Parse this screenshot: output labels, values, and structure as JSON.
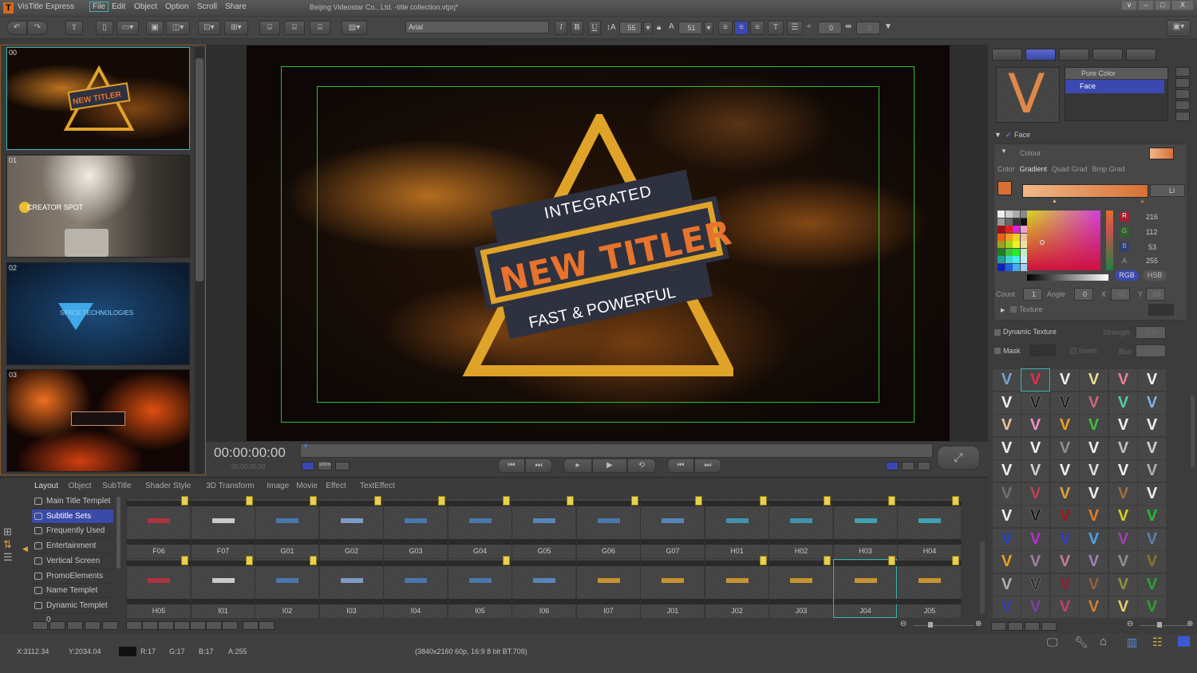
{
  "app": {
    "name": "VisTitle Express",
    "logo": "T",
    "window_title": "Beijing Videostar Co., Ltd. -title collection.vtprj*"
  },
  "menu": [
    "File",
    "Edit",
    "Object",
    "Option",
    "Scroll",
    "Share"
  ],
  "window_controls": [
    "∨",
    "–",
    "□",
    "X"
  ],
  "toolbar": {
    "font": "Arial",
    "font_size": "55",
    "char_width": "51",
    "line_spacing": "0",
    "char_spacing": "3"
  },
  "scenes": [
    {
      "num": "00"
    },
    {
      "num": "01"
    },
    {
      "num": "02"
    },
    {
      "num": "03"
    }
  ],
  "title_graphic": {
    "top": "INTEGRATED",
    "main": "NEW TITLER",
    "bottom": "FAST & POWERFUL",
    "colors": {
      "gold": "#e0a32a",
      "navy": "#2e3140",
      "orange": "#e8732c"
    }
  },
  "thumb_text": {
    "t00": "NEW TITLER",
    "t01": "CREATOR SPOT",
    "t02": "SPACE TECHNOLOGIES"
  },
  "transport": {
    "timecode": "00:00:00:00",
    "duration": "00:00:05:00",
    "zoom_label": "100%"
  },
  "bottom": {
    "tabs": [
      "Layout",
      "Object",
      "SubTitle",
      "Shader Style",
      "3D Transform",
      "Image",
      "Movie",
      "Effect",
      "TextEffect"
    ],
    "categories": [
      {
        "label": "Main Title Templet"
      },
      {
        "label": "Subtitle Sets",
        "selected": true
      },
      {
        "label": "Frequently Used"
      },
      {
        "label": "Entertainment"
      },
      {
        "label": "Vertical Screen"
      },
      {
        "label": "PromoElements"
      },
      {
        "label": "Name Templet"
      },
      {
        "label": "Dynamic Templet 0"
      }
    ],
    "templates_row1": [
      "F06",
      "F07",
      "G01",
      "G02",
      "G03",
      "G04",
      "G05",
      "G06",
      "G07",
      "H01",
      "H02",
      "H03",
      "H04"
    ],
    "templates_row2": [
      "H05",
      "I01",
      "I02",
      "I03",
      "I04",
      "I05",
      "I06",
      "I07",
      "J01",
      "J02",
      "J03",
      "J04",
      "J05"
    ],
    "selected_template": "J04"
  },
  "right": {
    "layer_type": "Pure Color",
    "layer_name": "Face",
    "section": "Face",
    "colour_label": "Colour",
    "fill_modes": [
      "Color",
      "Gradient",
      "Quad Grad",
      "Bmp Grad"
    ],
    "active_fill": "Gradient",
    "gradient_type": "Li",
    "rgb": {
      "r_label": "R",
      "r": "216",
      "g_label": "G",
      "g": "112",
      "b_label": "B",
      "b": "53",
      "a_label": "A",
      "a": "255"
    },
    "mode_buttons": [
      "RGB",
      "HSB"
    ],
    "count_label": "Count",
    "count": "1",
    "angle_label": "Angle",
    "angle": "0",
    "x_label": "X",
    "x": "62",
    "y_label": "Y",
    "y": "89",
    "texture_label": "Texture",
    "dynamic_texture_label": "Dynamic Texture",
    "strength_label": "Strength",
    "strength": "100",
    "mask_label": "Mask",
    "invert_label": "Invert",
    "blur_label": "Blur",
    "blur": "0",
    "gradient_colors": [
      "#f0b888",
      "#d87035"
    ],
    "style_colors": [
      "#7aa0d0",
      "#e03050",
      "#f0f0f0",
      "#e8e090",
      "#e88090",
      "#f0f0f0",
      "#f0f0f0",
      "#202020",
      "#202020",
      "#c86878",
      "#50d0a0",
      "#80b0f0",
      "#e8c0a0",
      "#f090c0",
      "#f0a020",
      "#40c040",
      "#f0f0f0",
      "#f0f0f0",
      "#f0f0f0",
      "#f0f0f0",
      "#909090",
      "#f0f0f0",
      "#c0c0c0",
      "#d0d0d0",
      "#f0f0f0",
      "#d0d0d0",
      "#f0f0f0",
      "#e0e0e0",
      "#f0f0f0",
      "#b0b0b0",
      "#707070",
      "#c04050",
      "#e0a040",
      "#f0f0f0",
      "#a07040",
      "#f0f0f0",
      "#f0f0f0",
      "#181818",
      "#a01818",
      "#e08020",
      "#d8d020",
      "#20c030",
      "#2040d0",
      "#b030d0",
      "#3040c0",
      "#50a0e0",
      "#a040b0",
      "#6080b0",
      "#e8a020",
      "#a080a0",
      "#c08090",
      "#a080b0",
      "#909090",
      "#8a7030",
      "#b0b0b0",
      "#303030",
      "#902030",
      "#906040",
      "#909040",
      "#30a040",
      "#3040b0",
      "#8040a0",
      "#c04070",
      "#d08030",
      "#e0d070",
      "#30a030"
    ]
  },
  "status": {
    "x": "X:3112.34",
    "y": "Y:2034.04",
    "pixel_color": "#111111",
    "r": "R:17",
    "g": "G:17",
    "b": "B:17",
    "a": "A:255",
    "format": "(3840x2160 60p, 16:9 8 bit BT.709)"
  }
}
